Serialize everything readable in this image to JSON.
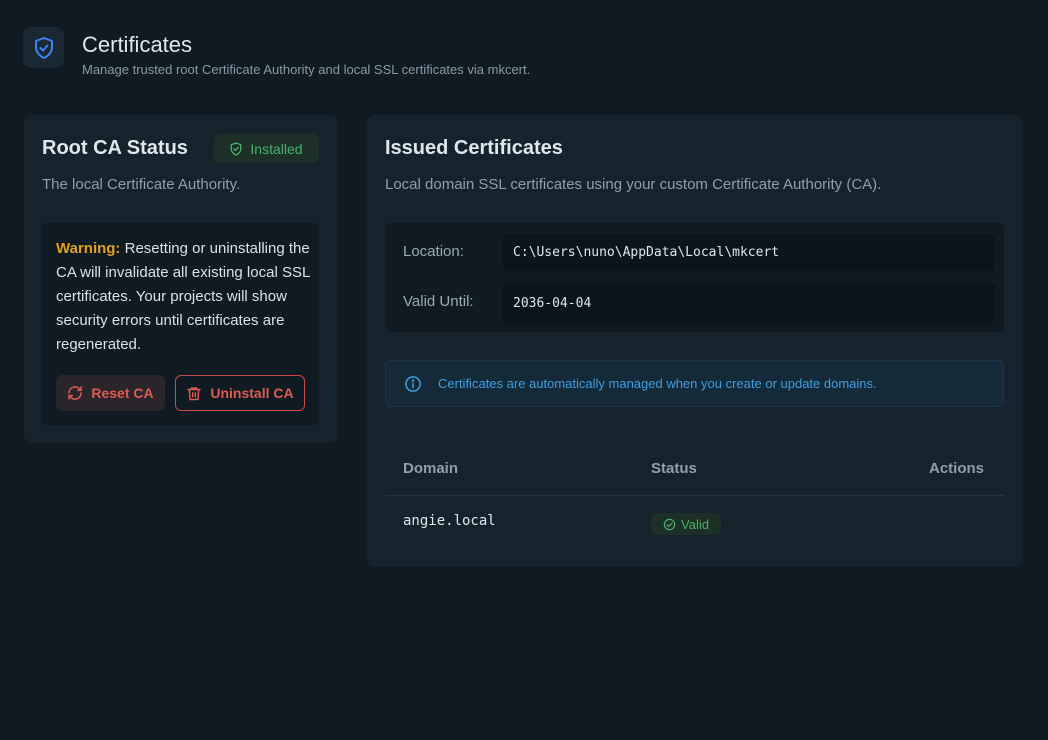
{
  "header": {
    "title": "Certificates",
    "subtitle": "Manage trusted root Certificate Authority and local SSL certificates via mkcert.",
    "icon": "shield-check-icon",
    "accent": "#3b82f6"
  },
  "root_ca": {
    "title": "Root CA Status",
    "status_badge": "Installed",
    "description": "The local Certificate Authority.",
    "warning_label": "Warning:",
    "warning_text": " Resetting or uninstalling the CA will invalidate all existing local SSL certificates. Your projects will show security errors until certificates are regenerated.",
    "reset_button": "Reset CA",
    "uninstall_button": "Uninstall CA"
  },
  "issued": {
    "title": "Issued Certificates",
    "description": "Local domain SSL certificates using your custom Certificate Authority (CA).",
    "location_label": "Location:",
    "location_value": "C:\\Users\\nuno\\AppData\\Local\\mkcert",
    "valid_until_label": "Valid Until:",
    "valid_until_value": "2036-04-04",
    "notice": "Certificates are automatically managed when you create or update domains.",
    "table": {
      "columns": [
        "Domain",
        "Status",
        "Actions"
      ],
      "rows": [
        {
          "domain": "angie.local",
          "status": "Valid"
        }
      ]
    }
  },
  "colors": {
    "success": "#4caf6a",
    "danger": "#e05a52",
    "warning": "#e0a020",
    "info": "#3d9ee0"
  }
}
